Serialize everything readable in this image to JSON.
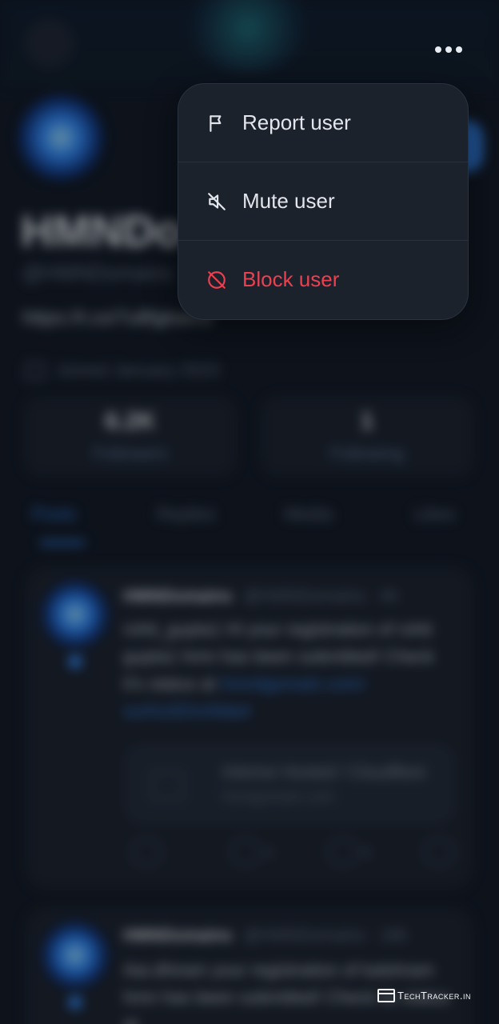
{
  "menu": {
    "items": [
      {
        "label": "Report user",
        "icon": "flag-icon"
      },
      {
        "label": "Mute user",
        "icon": "mute-icon"
      },
      {
        "label": "Block user",
        "icon": "block-icon",
        "color": "#ec4050"
      }
    ]
  },
  "more_button": {
    "icon": "more-horizontal-icon"
  },
  "profile": {
    "name": "HMNDo",
    "handle": "@HMNDomains",
    "url": "https://t.co/7u8fgkwmv",
    "joined": "Joined January 2023",
    "stats": [
      {
        "value": "6.2K",
        "label": "Followers"
      },
      {
        "value": "1",
        "label": "Following"
      }
    ],
    "tabs": [
      "Posts",
      "Replies",
      "Media",
      "Likes"
    ]
  },
  "posts": [
    {
      "author": "HMNDomains",
      "handle": "@HMNDomains · 4h",
      "text": "rohit_gupta1 Hi your registration of rohit gupta1 hmn has been submitted! Check it's status at",
      "link": "hmndgomain.com/ surl/ui3lJvri0da4",
      "embed_title": "Interive Hosted / Cloudflare",
      "embed_domain": "hmngomain.com",
      "replies": "4",
      "likes": "6"
    },
    {
      "author": "HMNDomains",
      "handle": "@HMNDomains · 18h",
      "text": "Aai.dhiram your registration of kalshram hmn has been submitted! Check its status at"
    }
  ],
  "watermark": {
    "text": "TechTracker.in"
  },
  "colors": {
    "accent": "#2f7fe6",
    "danger": "#ec4050",
    "menu_bg": "#1c222c"
  }
}
